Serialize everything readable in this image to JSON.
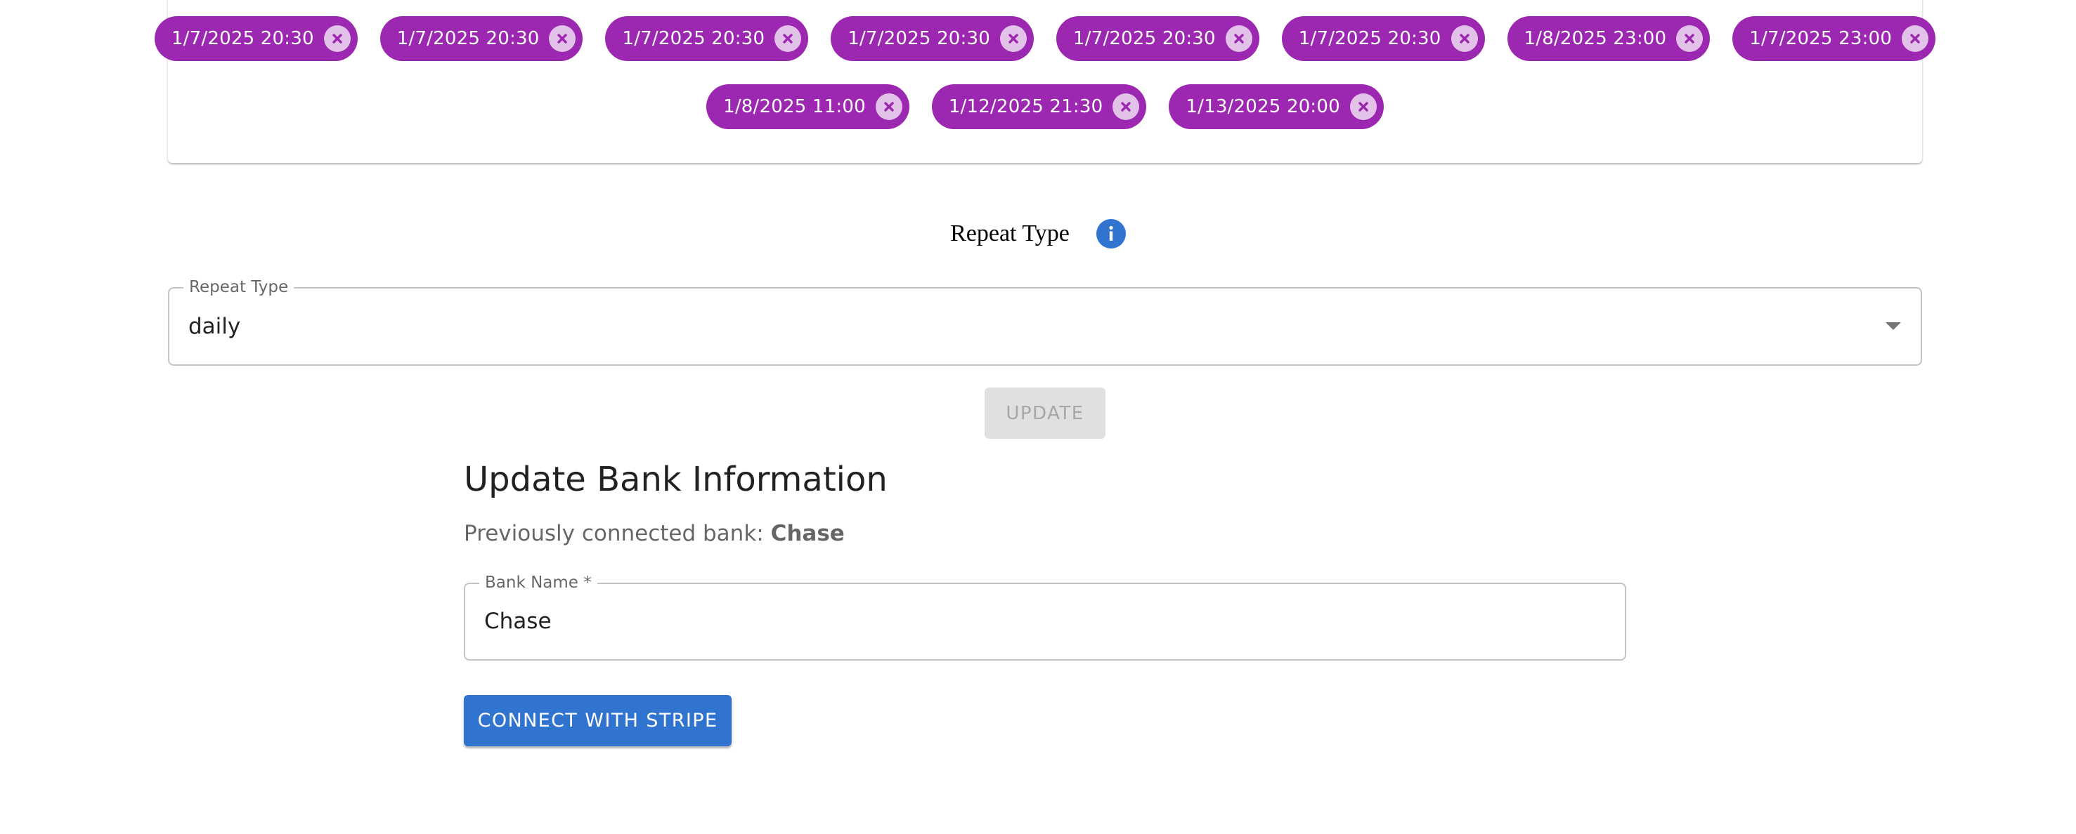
{
  "date_chips": {
    "row1": [
      {
        "label": "1/7/2025 20:30"
      },
      {
        "label": "1/7/2025 20:30"
      },
      {
        "label": "1/7/2025 20:30"
      },
      {
        "label": "1/7/2025 20:30"
      },
      {
        "label": "1/7/2025 20:30"
      },
      {
        "label": "1/7/2025 20:30"
      },
      {
        "label": "1/8/2025 23:00"
      },
      {
        "label": "1/7/2025 23:00"
      }
    ],
    "row2": [
      {
        "label": "1/8/2025 11:00"
      },
      {
        "label": "1/12/2025 21:30"
      },
      {
        "label": "1/13/2025 20:00"
      }
    ],
    "chip_color": "#9c27b0",
    "delete_icon": "cancel-circle-icon"
  },
  "repeat_section": {
    "heading": "Repeat Type",
    "info_icon": "info-icon",
    "select_label": "Repeat Type",
    "select_value": "daily",
    "update_label": "UPDATE",
    "update_disabled": true
  },
  "bank_section": {
    "title": "Update Bank Information",
    "prev_prefix": "Previously connected bank: ",
    "prev_bank": "Chase",
    "field_label": "Bank Name *",
    "field_value": "Chase",
    "connect_label": "CONNECT WITH STRIPE",
    "accent_color": "#3074d0"
  }
}
